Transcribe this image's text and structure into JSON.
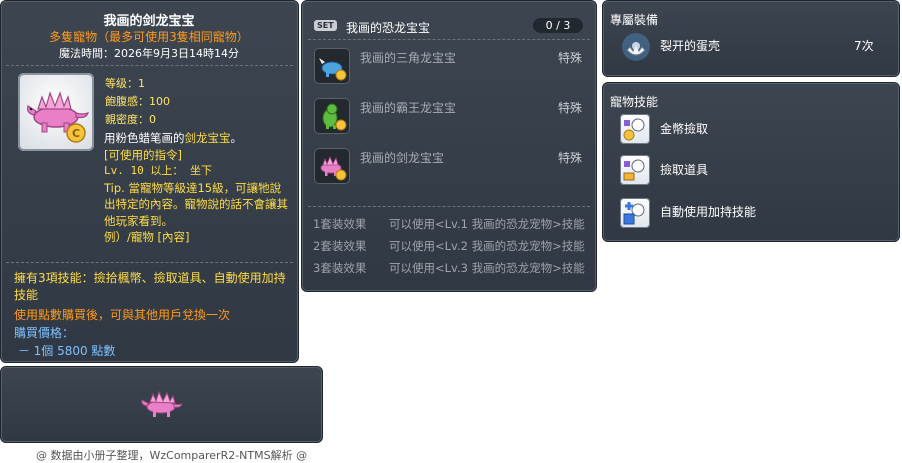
{
  "id_label": "05002283",
  "item": {
    "title": "我画的剑龙宝宝",
    "subtitle": "多隻寵物（最多可使用3隻相同寵物）",
    "magic_time": "魔法時間：2026年9月3日14時14分",
    "stats": {
      "level": "等级：1",
      "fullness": "飽腹感：100",
      "closeness": "親密度：0"
    },
    "desc": {
      "line1_prefix": "用粉色蜡笔画的",
      "line1_highlight": "剑龙宝宝",
      "line1_suffix": "。",
      "commands_title": "[可使用的指令]",
      "command1": "Lv. 10 以上：  坐下",
      "tip": "Tip. 當寵物等級達15級，可讓牠說出特定的內容。寵物說的話不會讓其他玩家看到。",
      "example": "例）/寵物 [內容]"
    },
    "bottom": {
      "skills": "擁有3項技能：撿拾楓幣、撿取道具、自動使用加持技能",
      "trade": "使用點數購買後，可與其他用戶兌換一次",
      "price_title": "購買價格：",
      "price": " － 1個 5800 點數"
    }
  },
  "set_panel": {
    "badge": "SET",
    "title": "我画的恐龙宝宝",
    "count": "0 / 3",
    "items": [
      {
        "name": "我画的三角龙宝宝",
        "type": "特殊"
      },
      {
        "name": "我画的霸王龙宝宝",
        "type": "特殊"
      },
      {
        "name": "我画的剑龙宝宝",
        "type": "特殊"
      }
    ],
    "effects": [
      {
        "name": "1套装效果",
        "text": "可以使用<Lv.1 我画的恐龙宠物>技能"
      },
      {
        "name": "2套装效果",
        "text": "可以使用<Lv.2 我画的恐龙宠物>技能"
      },
      {
        "name": "3套装效果",
        "text": "可以使用<Lv.3 我画的恐龙宠物>技能"
      }
    ]
  },
  "equip_panel": {
    "title": "專屬裝備",
    "item_name": "裂开的蛋壳",
    "item_count": "7次"
  },
  "skill_panel": {
    "title": "寵物技能",
    "skills": [
      "金幣撿取",
      "撿取道具",
      "自動使用加持技能"
    ]
  },
  "footer": "@ 数据由小册子整理，WzComparerR2-NTMS解析 @",
  "colors": {
    "panel": "#353d47",
    "highlight": "#ffdd44",
    "orange": "#ff9a1a",
    "blue": "#7ec0ff"
  }
}
